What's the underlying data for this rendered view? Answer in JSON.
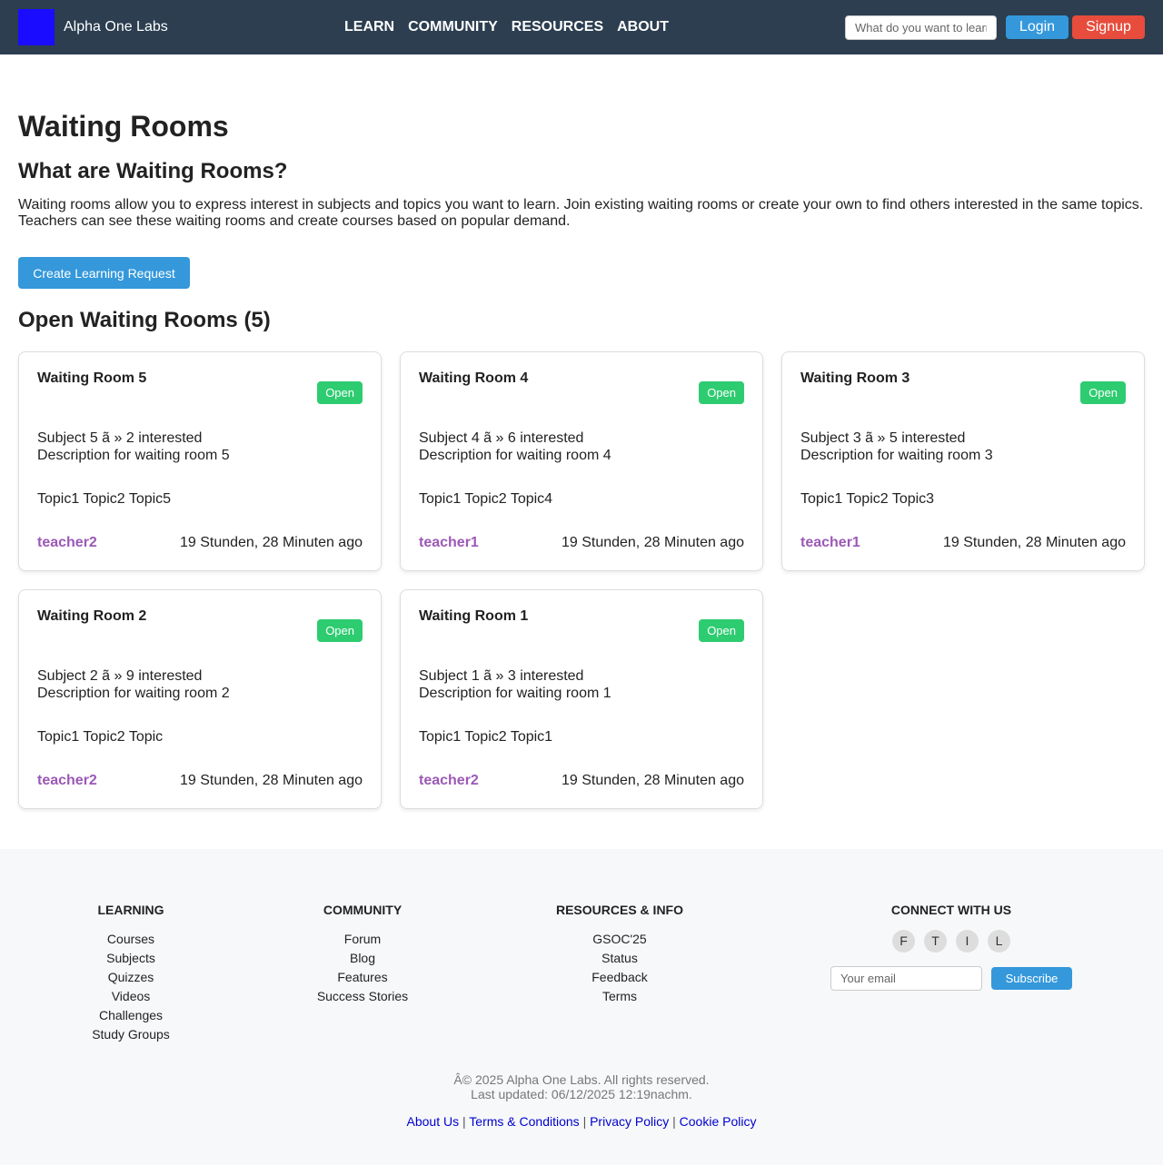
{
  "header": {
    "brand": "Alpha One Labs",
    "nav": [
      "LEARN",
      "COMMUNITY",
      "RESOURCES",
      "ABOUT"
    ],
    "search_placeholder": "What do you want to learn?",
    "login_label": "Login",
    "signup_label": "Signup",
    "colors": {
      "bar": "#2c3e50",
      "logo": "#1a0dff",
      "login": "#3498db",
      "signup": "#e74c3c"
    }
  },
  "main": {
    "title": "Waiting Rooms",
    "subtitle": "What are Waiting Rooms?",
    "intro": "Waiting rooms allow you to express interest in subjects and topics you want to learn. Join existing waiting rooms or create your own to find others interested in the same topics. Teachers can see these waiting rooms and create courses based on popular demand.",
    "create_button": "Create Learning Request",
    "section_title": "Open Waiting Rooms (5)",
    "rooms": [
      {
        "title": "Waiting Room 5",
        "status": "Open",
        "subject": "Subject 5 ã    » 2 interested",
        "description": "Description for waiting room 5",
        "topics": "Topic1 Topic2 Topic5",
        "author": "teacher2",
        "time": "19 Stunden, 28 Minuten ago"
      },
      {
        "title": "Waiting Room 4",
        "status": "Open",
        "subject": "Subject 4 ã    » 6 interested",
        "description": "Description for waiting room 4",
        "topics": "Topic1 Topic2 Topic4",
        "author": "teacher1",
        "time": "19 Stunden, 28 Minuten ago"
      },
      {
        "title": "Waiting Room 3",
        "status": "Open",
        "subject": "Subject 3 ã    » 5 interested",
        "description": "Description for waiting room 3",
        "topics": "Topic1 Topic2 Topic3",
        "author": "teacher1",
        "time": "19 Stunden, 28 Minuten ago"
      },
      {
        "title": "Waiting Room 2",
        "status": "Open",
        "subject": "Subject 2 ã    » 9 interested",
        "description": "Description for waiting room 2",
        "topics": "Topic1 Topic2 Topic",
        "author": "teacher2",
        "time": "19 Stunden, 28 Minuten ago"
      },
      {
        "title": "Waiting Room 1",
        "status": "Open",
        "subject": "Subject 1 ã    » 3 interested",
        "description": "Description for waiting room 1",
        "topics": "Topic1 Topic2 Topic1",
        "author": "teacher2",
        "time": "19 Stunden, 28 Minuten ago"
      }
    ]
  },
  "footer": {
    "learning": {
      "heading": "LEARNING",
      "links": [
        "Courses",
        "Subjects",
        "Quizzes",
        "Videos",
        "Challenges",
        "Study Groups"
      ]
    },
    "community": {
      "heading": "COMMUNITY",
      "links": [
        "Forum",
        "Blog",
        "Features",
        "Success Stories"
      ]
    },
    "resources": {
      "heading": "RESOURCES & INFO",
      "links": [
        "GSOC'25",
        "Status",
        "Feedback",
        "Terms"
      ]
    },
    "connect": {
      "heading": "CONNECT WITH US",
      "social": [
        "F",
        "T",
        "I",
        "L"
      ],
      "email_placeholder": "Your email",
      "subscribe_label": "Subscribe"
    },
    "copyright": "Â© 2025 Alpha One Labs. All rights reserved.",
    "last_updated": "Last updated: 06/12/2025 12:19nachm.",
    "legal": [
      "About Us",
      "Terms & Conditions",
      "Privacy Policy",
      "Cookie Policy"
    ],
    "separator": "|"
  }
}
